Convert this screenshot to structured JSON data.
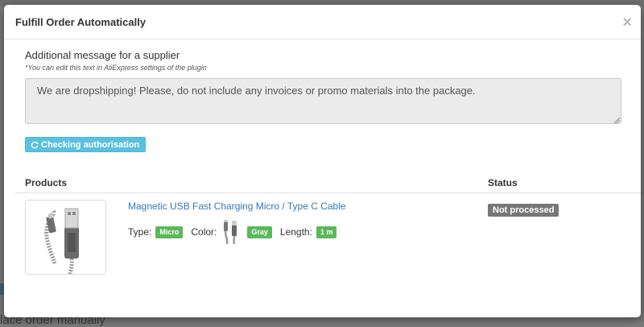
{
  "modal": {
    "title": "Fulfill Order Automatically",
    "close_label": "×"
  },
  "message": {
    "label": "Additional message for a supplier",
    "hint": "*You can edit this text in AliExpress settings of the plugin",
    "value": "We are dropshipping! Please, do not include any invoices or promo materials into the package."
  },
  "auth_button": {
    "label": "Checking authorisation",
    "icon": "refresh-icon",
    "color": "#5bc0de"
  },
  "table": {
    "headers": [
      "Products",
      "Status"
    ],
    "rows": [
      {
        "product_name": "Magnetic USB Fast Charging Micro / Type C Cable",
        "thumbnail_icon": "usb-cable-icon",
        "attributes": {
          "type_label": "Type:",
          "type_value": "Micro",
          "color_label": "Color:",
          "color_value": "Gray",
          "length_label": "Length:",
          "length_value": "1 m"
        },
        "status": "Not processed"
      }
    ]
  },
  "background": {
    "bottom_text": "lace order manually"
  },
  "colors": {
    "badge_green": "#5cb85c",
    "status_gray": "#777777",
    "link_blue": "#337ab7"
  }
}
